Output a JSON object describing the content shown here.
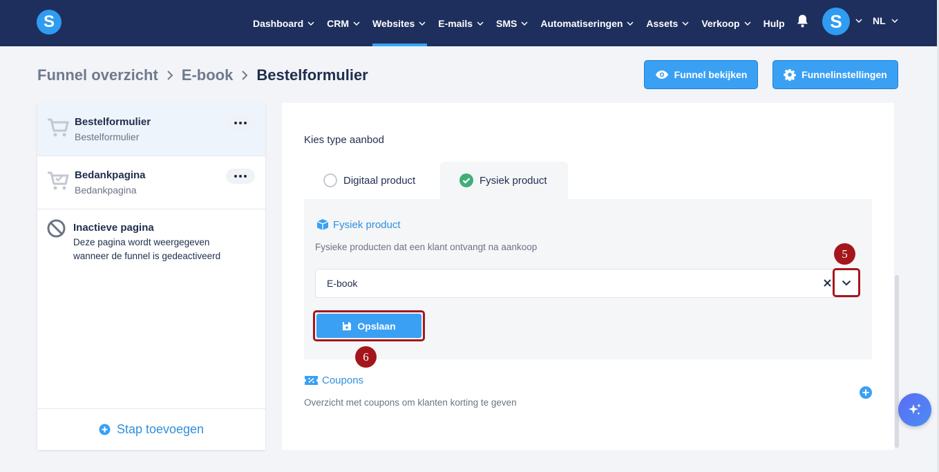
{
  "header": {
    "logo_letter": "S",
    "nav": [
      {
        "label": "Dashboard"
      },
      {
        "label": "CRM"
      },
      {
        "label": "Websites",
        "active": true
      },
      {
        "label": "E-mails"
      },
      {
        "label": "SMS"
      },
      {
        "label": "Automatiseringen"
      },
      {
        "label": "Assets"
      },
      {
        "label": "Verkoop"
      },
      {
        "label": "Hulp"
      }
    ],
    "avatar_letter": "S",
    "language": "NL"
  },
  "breadcrumb": {
    "items": [
      "Funnel overzicht",
      "E-book",
      "Bestelformulier"
    ]
  },
  "actions": {
    "view_funnel": "Funnel bekijken",
    "funnel_settings": "Funnelinstellingen"
  },
  "sidebar": {
    "steps": [
      {
        "title": "Bestelformulier",
        "subtitle": "Bestelformulier",
        "selected": true
      },
      {
        "title": "Bedankpagina",
        "subtitle": "Bedankpagina"
      }
    ],
    "inactive": {
      "title": "Inactieve pagina",
      "description": "Deze pagina wordt weergegeven wanneer de funnel is gedeactiveerd"
    },
    "add_step": "Stap toevoegen"
  },
  "offer": {
    "label": "Kies type aanbod",
    "tabs": [
      {
        "label": "Digitaal product",
        "selected": false
      },
      {
        "label": "Fysiek product",
        "selected": true
      }
    ],
    "physical": {
      "title": "Fysiek product",
      "description": "Fysieke producten dat een klant ontvangt na aankoop",
      "selected_value": "E-book"
    },
    "save_label": "Opslaan"
  },
  "coupons": {
    "title": "Coupons",
    "description": "Overzicht met coupons om klanten korting te geven"
  },
  "annotations": {
    "dropdown_step": "5",
    "save_step": "6"
  },
  "colors": {
    "nav_bg": "#1e2f5d",
    "accent": "#3aa0f3",
    "highlight": "#a5161c",
    "success": "#3fae78"
  }
}
